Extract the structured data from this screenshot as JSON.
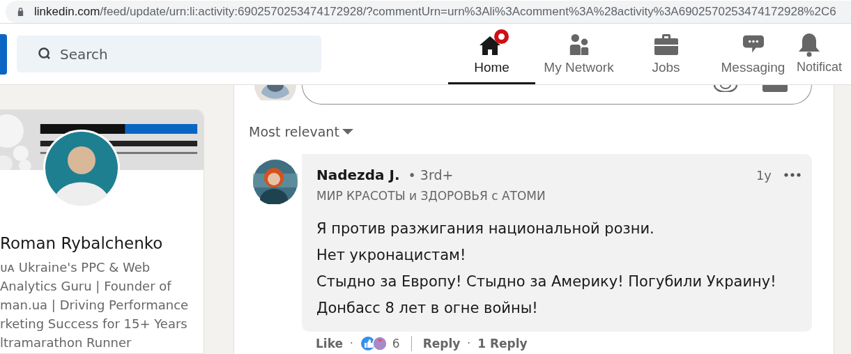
{
  "address_bar": {
    "host": "linkedin.com",
    "path": "/feed/update/urn:li:activity:6902570253474172928/?commentUrn=urn%3Ali%3Acomment%3A%28activity%3A6902570253474172928%2C6"
  },
  "search": {
    "placeholder": "Search"
  },
  "nav": [
    {
      "kind": "home",
      "label": "Home",
      "selected": true,
      "badge": true
    },
    {
      "kind": "network",
      "label": "My Network",
      "selected": false,
      "badge": false
    },
    {
      "kind": "jobs",
      "label": "Jobs",
      "selected": false,
      "badge": false
    },
    {
      "kind": "messaging",
      "label": "Messaging",
      "selected": false,
      "badge": false
    },
    {
      "kind": "notifications",
      "label": "Notificat",
      "selected": false,
      "badge": false
    }
  ],
  "profile": {
    "name": "Roman Rybalchenko",
    "headline_lines": [
      "ᴜᴀ Ukraine's PPC & Web",
      "Analytics Guru | Founder of",
      "man.ua | Driving Performance",
      "rketing Success for 15+ Years",
      "ltramarathon Runner"
    ]
  },
  "sort": {
    "label": "Most relevant"
  },
  "comment": {
    "author": "Nadezda J.",
    "degree": "• 3rd+",
    "time": "1y",
    "subtitle": "МИР КРАСОТЫ и ЗДОРОВЬЯ с АТОМИ",
    "lines": [
      "Я против разжигания национальной розни.",
      "Нет укронацистам!",
      "Стыдно за Европу! Стыдно за Америку! Погубили Украину!",
      "Донбасс 8 лет в огне войны!"
    ],
    "actions": [
      {
        "kind": "link",
        "label": "Like"
      },
      {
        "kind": "dot",
        "label": "·"
      },
      {
        "kind": "reactions",
        "label": "6"
      },
      {
        "kind": "divider"
      },
      {
        "kind": "link",
        "label": "Reply"
      },
      {
        "kind": "dot",
        "label": "·"
      },
      {
        "kind": "link",
        "label": "1 Reply"
      }
    ]
  }
}
